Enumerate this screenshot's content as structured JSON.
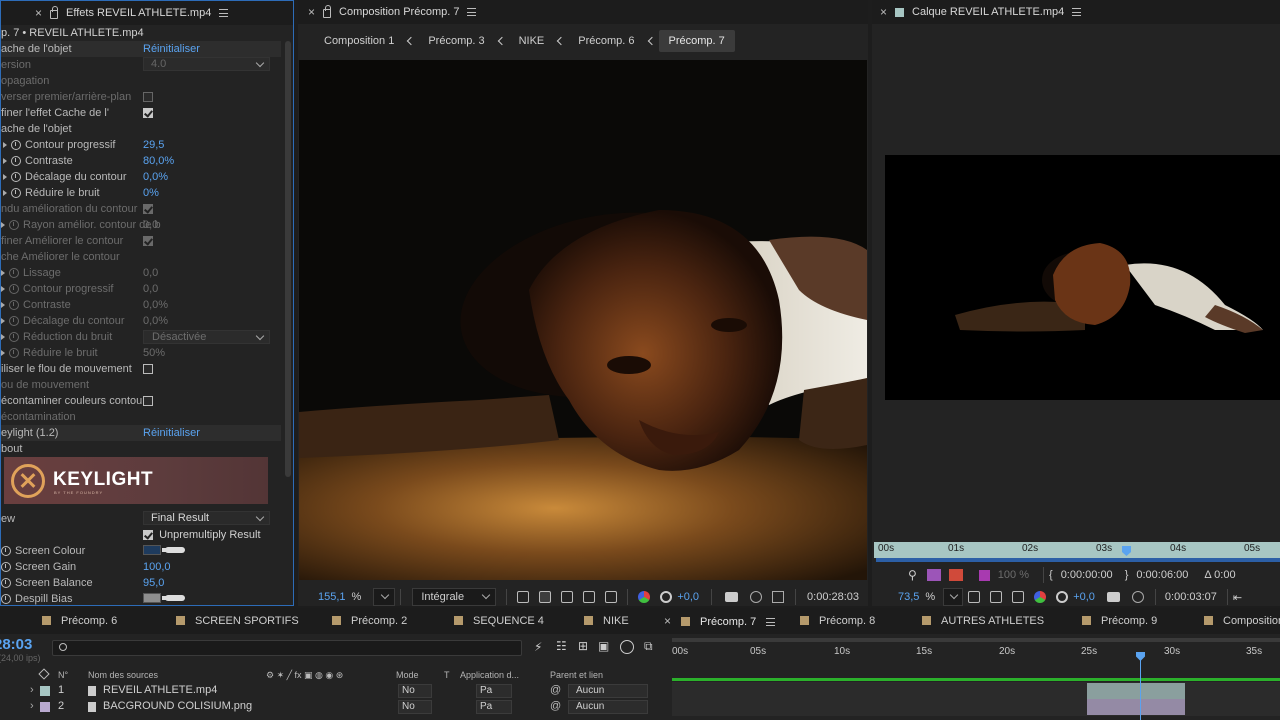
{
  "effects_panel": {
    "tab_title": "Effets  REVEIL ATHLETE.mp4",
    "subtitle": "p. 7 • REVEIL ATHLETE.mp4",
    "rows": [
      {
        "label": "ache de l'objet",
        "value": "Réinitialiser"
      },
      {
        "label": "ersion",
        "value": "4.0"
      },
      {
        "label": "opagation",
        "value": ""
      },
      {
        "label": "verser premier/arrière-plan",
        "value": ""
      },
      {
        "label": "finer l'effet Cache de l'",
        "value": ""
      },
      {
        "label": "ache de l'objet",
        "value": ""
      },
      {
        "label": "Contour progressif",
        "value": "29,5"
      },
      {
        "label": "Contraste",
        "value": "80,0%"
      },
      {
        "label": "Décalage du contour",
        "value": "0,0%"
      },
      {
        "label": "Réduire le bruit",
        "value": "0%"
      },
      {
        "label": "ndu amélioration du contour",
        "value": ""
      },
      {
        "label": "Rayon amélior. contour de b",
        "value": "0,0"
      },
      {
        "label": "finer Améliorer le contour",
        "value": ""
      },
      {
        "label": "che Améliorer le contour",
        "value": ""
      },
      {
        "label": "Lissage",
        "value": "0,0"
      },
      {
        "label": "Contour progressif",
        "value": "0,0"
      },
      {
        "label": "Contraste",
        "value": "0,0%"
      },
      {
        "label": "Décalage du contour",
        "value": "0,0%"
      },
      {
        "label": "Réduction du bruit",
        "value": "Désactivée"
      },
      {
        "label": "Réduire le bruit",
        "value": "50%"
      },
      {
        "label": "iliser le flou de mouvement",
        "value": ""
      },
      {
        "label": "ou de mouvement",
        "value": ""
      },
      {
        "label": "écontaminer couleurs contour",
        "value": ""
      },
      {
        "label": "écontamination",
        "value": ""
      },
      {
        "label": "eylight (1.2)",
        "value": "Réinitialiser"
      },
      {
        "label": "bout",
        "value": ""
      },
      {
        "label": "ew",
        "value": "Final Result"
      },
      {
        "label": "",
        "value": "Unpremultiply Result"
      },
      {
        "label": "Screen Colour",
        "value": ""
      },
      {
        "label": "Screen Gain",
        "value": "100,0"
      },
      {
        "label": "Screen Balance",
        "value": "95,0"
      },
      {
        "label": "Despill Bias",
        "value": ""
      }
    ],
    "logo_text": "KEYLIGHT",
    "logo_sub": "BY THE FOUNDRY"
  },
  "comp_panel": {
    "tab_title": "Composition  Précomp. 7",
    "breadcrumbs": [
      "Composition 1",
      "Précomp. 3",
      "NIKE",
      "Précomp. 6",
      "Précomp. 7"
    ],
    "zoom": "155,1",
    "zoom_unit": "%",
    "resolution": "Intégrale",
    "exposure": "+0,0",
    "timecode": "0:00:28:03"
  },
  "layer_panel": {
    "tab_title": "Calque  REVEIL ATHLETE.mp4",
    "ruler_ticks": [
      "00s",
      "01s",
      "02s",
      "03s",
      "04s",
      "05s"
    ],
    "opacity": "100 %",
    "in_time": "0:00:00:00",
    "out_time": "0:00:06:00",
    "duration": "Δ 0:00",
    "zoom": "73,5",
    "zoom_unit": "%",
    "exposure": "+0,0",
    "timecode": "0:00:03:07"
  },
  "timeline": {
    "tabs": [
      "Précomp. 6",
      "SCREEN SPORTIFS",
      "Précomp. 2",
      "SEQUENCE 4",
      "NIKE",
      "Précomp. 7",
      "Précomp. 8",
      "AUTRES ATHLETES",
      "Précomp. 9",
      "Composition"
    ],
    "current_time": "28:03",
    "fps": "(24,00 ips)",
    "columns": {
      "num": "N°",
      "source": "Nom des sources",
      "mode": "Mode",
      "t": "T",
      "app": "Application d...",
      "parent": "Parent et lien"
    },
    "layers": [
      {
        "num": "1",
        "name": "REVEIL ATHLETE.mp4",
        "mode": "No",
        "app": "Pa",
        "parent": "Aucun",
        "color": "#a7c6c3"
      },
      {
        "num": "2",
        "name": "BACGROUND COLISIUM.png",
        "mode": "No",
        "app": "Pa",
        "parent": "Aucun",
        "color": "#b9a9cf"
      }
    ],
    "ruler": [
      "00s",
      "05s",
      "10s",
      "15s",
      "20s",
      "25s",
      "30s",
      "35s"
    ]
  }
}
